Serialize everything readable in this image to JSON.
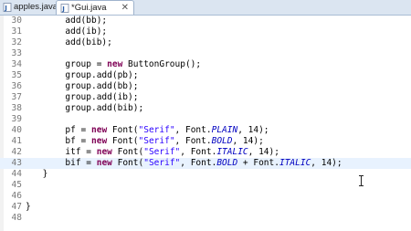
{
  "tabs": [
    {
      "label": "apples.java",
      "active": false
    },
    {
      "label": "*Gui.java",
      "active": true,
      "close": "✕"
    }
  ],
  "editor": {
    "lines": [
      {
        "num": "30",
        "tokens": [
          {
            "t": "add(bb);",
            "c": "p"
          }
        ]
      },
      {
        "num": "31",
        "tokens": [
          {
            "t": "add(ib);",
            "c": "p"
          }
        ]
      },
      {
        "num": "32",
        "tokens": [
          {
            "t": "add(bib);",
            "c": "p"
          }
        ]
      },
      {
        "num": "33",
        "tokens": []
      },
      {
        "num": "34",
        "tokens": [
          {
            "t": "group = ",
            "c": "p"
          },
          {
            "t": "new",
            "c": "kw"
          },
          {
            "t": " ButtonGroup();",
            "c": "p"
          }
        ]
      },
      {
        "num": "35",
        "tokens": [
          {
            "t": "group.add(pb);",
            "c": "p"
          }
        ]
      },
      {
        "num": "36",
        "tokens": [
          {
            "t": "group.add(bb);",
            "c": "p"
          }
        ]
      },
      {
        "num": "37",
        "tokens": [
          {
            "t": "group.add(ib);",
            "c": "p"
          }
        ]
      },
      {
        "num": "38",
        "tokens": [
          {
            "t": "group.add(bib);",
            "c": "p"
          }
        ]
      },
      {
        "num": "39",
        "tokens": []
      },
      {
        "num": "40",
        "tokens": [
          {
            "t": "pf = ",
            "c": "p"
          },
          {
            "t": "new",
            "c": "kw"
          },
          {
            "t": " Font(",
            "c": "p"
          },
          {
            "t": "\"Serif\"",
            "c": "str"
          },
          {
            "t": ", Font.",
            "c": "p"
          },
          {
            "t": "PLAIN",
            "c": "fld"
          },
          {
            "t": ", 14);",
            "c": "p"
          }
        ]
      },
      {
        "num": "41",
        "tokens": [
          {
            "t": "bf = ",
            "c": "p"
          },
          {
            "t": "new",
            "c": "kw"
          },
          {
            "t": " Font(",
            "c": "p"
          },
          {
            "t": "\"Serif\"",
            "c": "str"
          },
          {
            "t": ", Font.",
            "c": "p"
          },
          {
            "t": "BOLD",
            "c": "fld"
          },
          {
            "t": ", 14);",
            "c": "p"
          }
        ]
      },
      {
        "num": "42",
        "tokens": [
          {
            "t": "itf = ",
            "c": "p"
          },
          {
            "t": "new",
            "c": "kw"
          },
          {
            "t": " Font(",
            "c": "p"
          },
          {
            "t": "\"Serif\"",
            "c": "str"
          },
          {
            "t": ", Font.",
            "c": "p"
          },
          {
            "t": "ITALIC",
            "c": "fld"
          },
          {
            "t": ", 14);",
            "c": "p"
          }
        ]
      },
      {
        "num": "43",
        "current": true,
        "tokens": [
          {
            "t": "bif = ",
            "c": "p"
          },
          {
            "t": "new",
            "c": "kw"
          },
          {
            "t": " Font(",
            "c": "p"
          },
          {
            "t": "\"Serif\"",
            "c": "str"
          },
          {
            "t": ", Font.",
            "c": "p"
          },
          {
            "t": "BOLD",
            "c": "fld"
          },
          {
            "t": " + Font.",
            "c": "p"
          },
          {
            "t": "ITALIC",
            "c": "fld"
          },
          {
            "t": ", 14);",
            "c": "p"
          }
        ]
      },
      {
        "num": "44",
        "tokens": [
          {
            "t": "}",
            "c": "p"
          }
        ]
      },
      {
        "num": "45",
        "tokens": []
      },
      {
        "num": "46",
        "tokens": []
      },
      {
        "num": "47",
        "tokens": [
          {
            "t": "}",
            "c": "p"
          }
        ]
      },
      {
        "num": "48",
        "tokens": []
      }
    ]
  },
  "icons": {
    "java_file": "java-file-icon",
    "close": "close-icon",
    "cursor": "text-cursor-icon"
  },
  "colors": {
    "keyword": "#7f0055",
    "string": "#2a00ff",
    "constant": "#0000c0",
    "current_line": "#e8f2fe",
    "tab_bar": "#dbe5f1"
  }
}
